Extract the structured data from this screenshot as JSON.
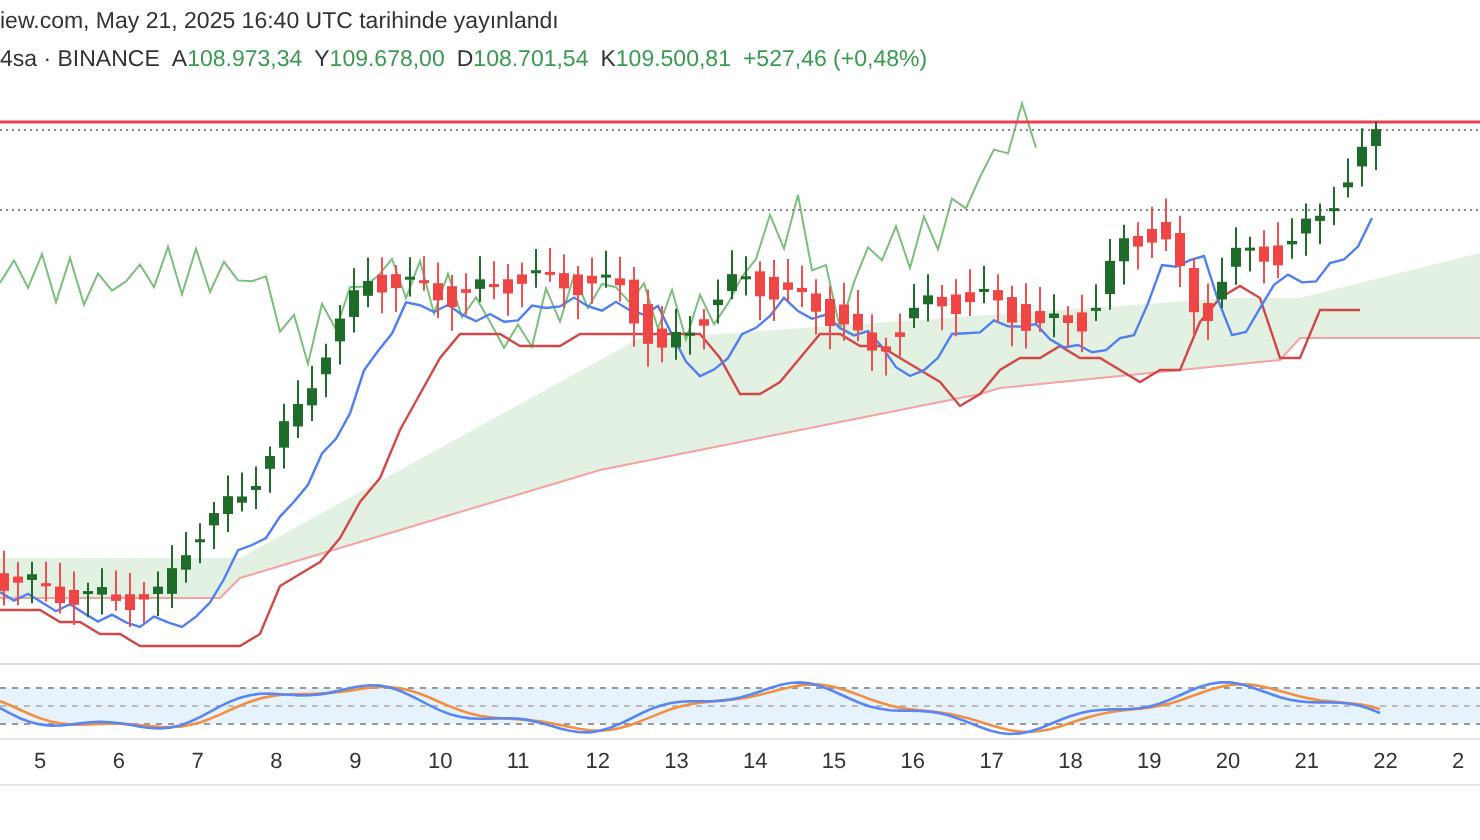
{
  "header": {
    "published": "iew.com, May 21, 2025 16:40 UTC tarihinde yayınlandı"
  },
  "legend": {
    "symbol": "4sa · BINANCE",
    "fields": [
      {
        "label": "A",
        "value": "108.973,34"
      },
      {
        "label": "Y",
        "value": "109.678,00"
      },
      {
        "label": "D",
        "value": "108.701,54"
      },
      {
        "label": "K",
        "value": "109.500,81"
      }
    ],
    "change": "+527,46 (+0,48%)"
  },
  "x_axis": {
    "labels": [
      "5",
      "6",
      "7",
      "8",
      "9",
      "10",
      "11",
      "12",
      "13",
      "14",
      "15",
      "16",
      "17",
      "18",
      "19",
      "20",
      "21",
      "22",
      "2"
    ]
  }
}
